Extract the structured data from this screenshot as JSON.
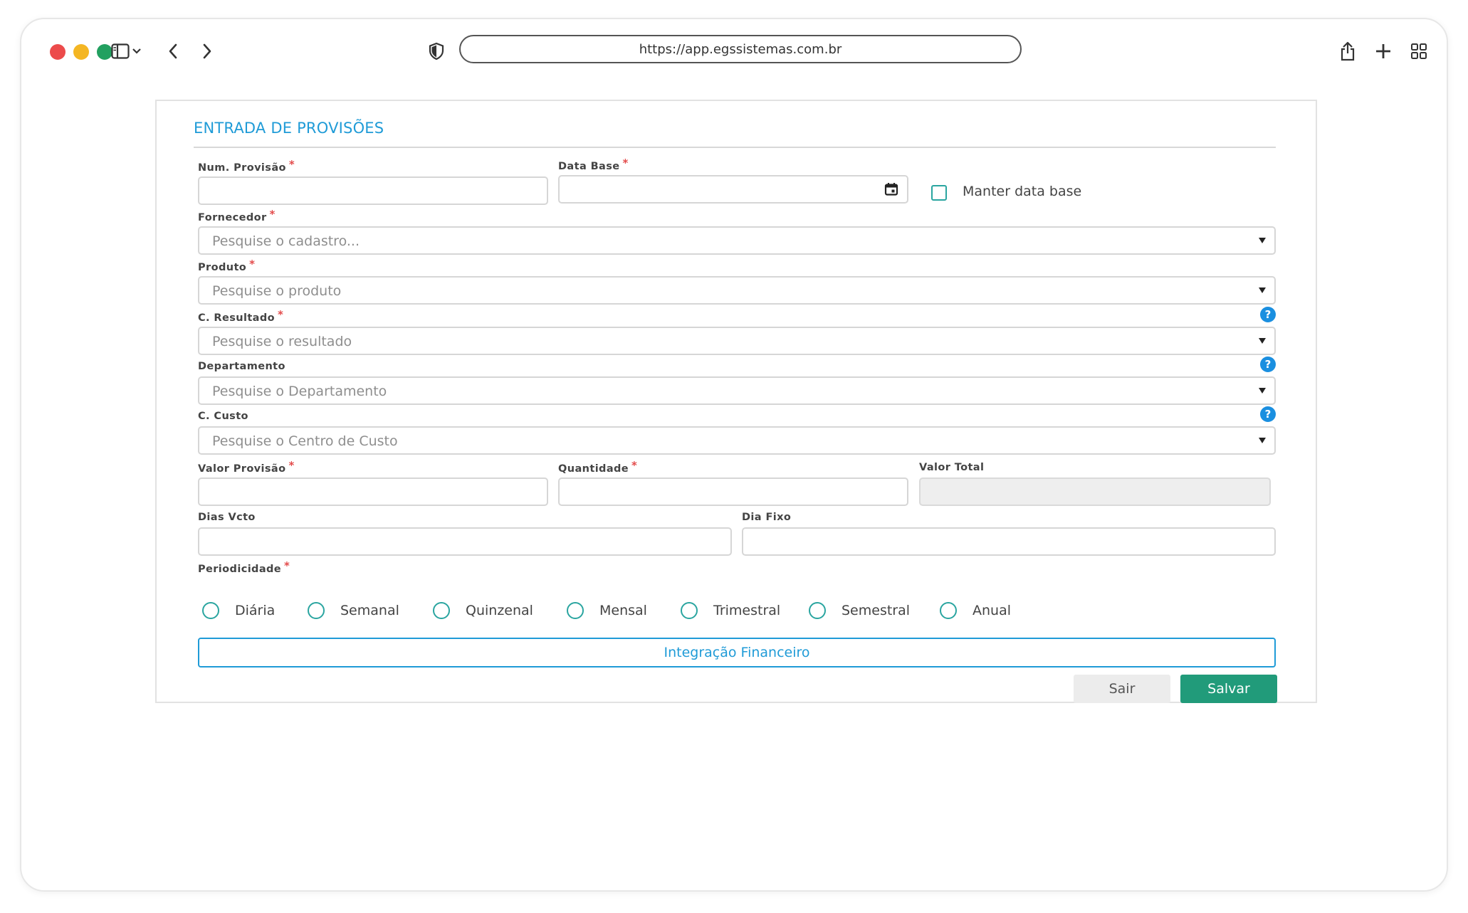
{
  "browser": {
    "url": "https://app.egssistemas.com.br"
  },
  "form": {
    "title": "ENTRADA DE PROVISÕES",
    "required_mark": "*",
    "help_glyph": "?",
    "fields": {
      "num_provisao": {
        "label": "Num. Provisão",
        "value": ""
      },
      "data_base": {
        "label": "Data Base",
        "value": ""
      },
      "manter_data_base": {
        "label": "Manter data base",
        "checked": false
      },
      "fornecedor": {
        "label": "Fornecedor",
        "placeholder": "Pesquise o cadastro..."
      },
      "produto": {
        "label": "Produto",
        "placeholder": "Pesquise o produto"
      },
      "c_resultado": {
        "label": "C. Resultado",
        "placeholder": "Pesquise o resultado"
      },
      "departamento": {
        "label": "Departamento",
        "placeholder": "Pesquise o Departamento"
      },
      "c_custo": {
        "label": "C. Custo",
        "placeholder": "Pesquise o Centro de Custo"
      },
      "valor_provisao": {
        "label": "Valor Provisão",
        "value": ""
      },
      "quantidade": {
        "label": "Quantidade",
        "value": ""
      },
      "valor_total": {
        "label": "Valor Total",
        "value": ""
      },
      "dias_vcto": {
        "label": "Dias Vcto",
        "value": ""
      },
      "dia_fixo": {
        "label": "Dia Fixo",
        "value": ""
      }
    },
    "periodicidade": {
      "label": "Periodicidade",
      "options": [
        "Diária",
        "Semanal",
        "Quinzenal",
        "Mensal",
        "Trimestral",
        "Semestral",
        "Anual"
      ],
      "selected": null
    },
    "integracao_label": "Integração Financeiro",
    "buttons": {
      "sair": "Sair",
      "salvar": "Salvar"
    }
  },
  "colors": {
    "accent_blue": "#1f9bd7",
    "teal": "#2aa5a0",
    "save_green": "#219b7a",
    "required_red": "#e34b4b",
    "help_blue": "#1a8fe0"
  },
  "icons": [
    "sidebar-toggle-icon",
    "chevron-down-icon",
    "back-arrow-icon",
    "forward-arrow-icon",
    "shield-icon",
    "share-icon",
    "new-tab-plus-icon",
    "tab-grid-icon",
    "calendar-icon",
    "help-icon"
  ]
}
